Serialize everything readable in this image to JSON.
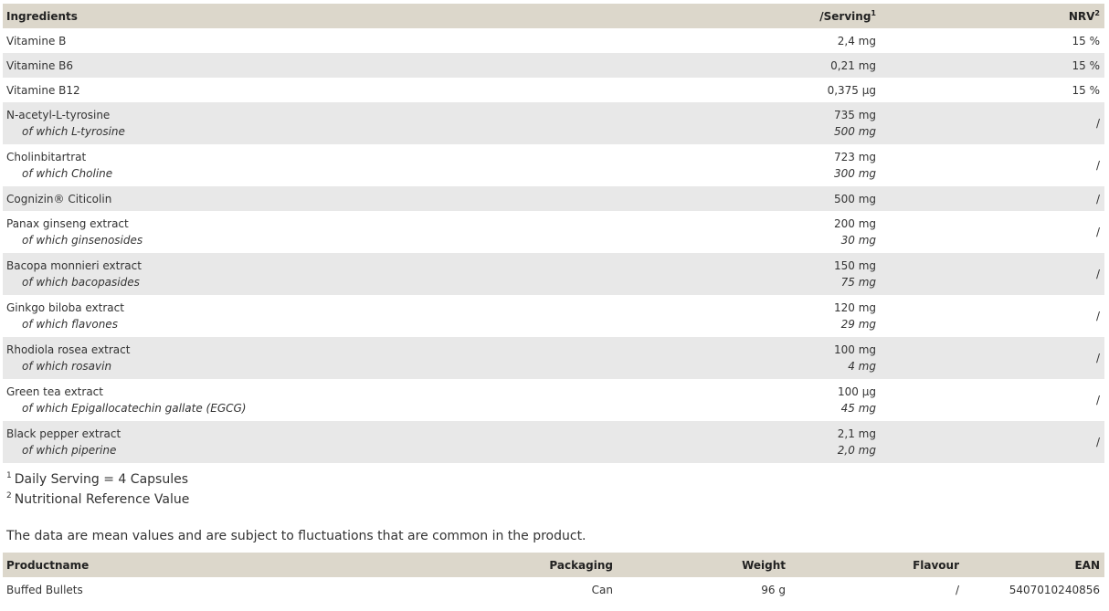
{
  "ingredients_table": {
    "headers": {
      "name": "Ingredients",
      "serving": "/Serving",
      "serving_sup": "1",
      "nrv": "NRV",
      "nrv_sup": "2"
    },
    "rows": [
      {
        "name": "Vitamine B",
        "serving": "2,4 mg",
        "nrv": "15 %"
      },
      {
        "name": "Vitamine B6",
        "serving": "0,21 mg",
        "nrv": "15 %"
      },
      {
        "name": "Vitamine B12",
        "serving": "0,375 µg",
        "nrv": "15 %"
      },
      {
        "name": "N-acetyl-L-tyrosine",
        "sub_name": "of which L-tyrosine",
        "serving": "735 mg",
        "sub_serving": "500 mg",
        "nrv": "/"
      },
      {
        "name": "Cholinbitartrat",
        "sub_name": "of which Choline",
        "serving": "723 mg",
        "sub_serving": "300 mg",
        "nrv": "/"
      },
      {
        "name": "Cognizin® Citicolin",
        "serving": "500 mg",
        "nrv": "/"
      },
      {
        "name": "Panax ginseng extract",
        "sub_name": "of which ginsenosides",
        "serving": "200 mg",
        "sub_serving": "30 mg",
        "nrv": "/"
      },
      {
        "name": "Bacopa monnieri extract",
        "sub_name": "of which bacopasides",
        "serving": "150 mg",
        "sub_serving": "75 mg",
        "nrv": "/"
      },
      {
        "name": "Ginkgo biloba extract",
        "sub_name": "of which flavones",
        "serving": "120 mg",
        "sub_serving": "29 mg",
        "nrv": "/"
      },
      {
        "name": "Rhodiola rosea extract",
        "sub_name": "of which rosavin",
        "serving": "100 mg",
        "sub_serving": "4 mg",
        "nrv": "/"
      },
      {
        "name": "Green tea extract",
        "sub_name": "of which Epigallocatechin gallate (EGCG)",
        "serving": "100 µg",
        "sub_serving": "45 mg",
        "nrv": "/"
      },
      {
        "name": "Black pepper extract",
        "sub_name": "of which piperine",
        "serving": "2,1 mg",
        "sub_serving": "2,0 mg",
        "nrv": "/"
      }
    ]
  },
  "footnotes": [
    {
      "marker": "1",
      "text": "Daily Serving = 4 Capsules"
    },
    {
      "marker": "2",
      "text": "Nutritional Reference Value"
    }
  ],
  "disclaimer": "The data are mean values and are subject to fluctuations that are common in the product.",
  "product_table": {
    "headers": [
      "Productname",
      "Packaging",
      "Weight",
      "Flavour",
      "EAN"
    ],
    "row": {
      "name": "Buffed Bullets",
      "packaging": "Can",
      "weight": "96 g",
      "flavour": "/",
      "ean": "5407010240856"
    }
  },
  "colors": {
    "header_bg": "#dcd7cb",
    "alt_row_bg": "#e8e8e8",
    "text": "#333333"
  }
}
